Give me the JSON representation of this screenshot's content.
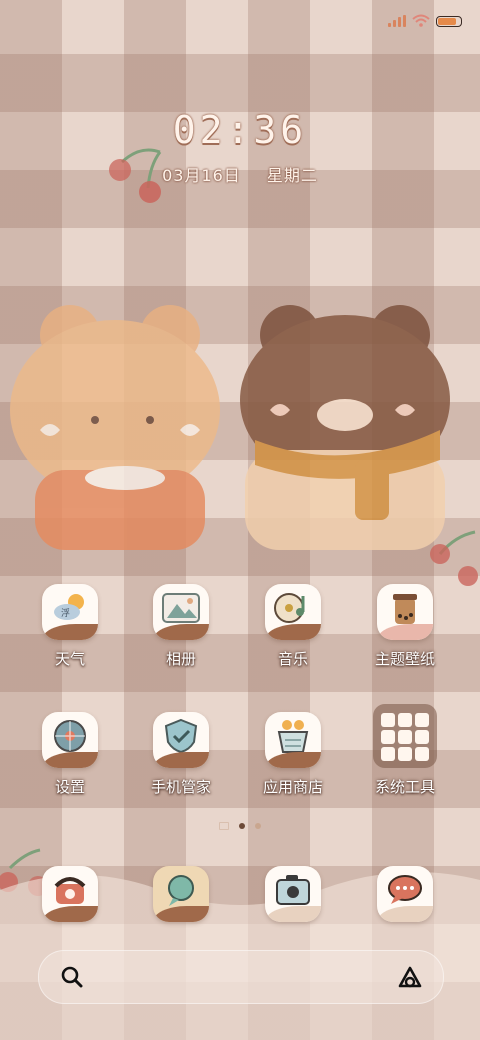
{
  "status": {
    "signal_icon": "signal-icon",
    "wifi_icon": "wifi-icon",
    "battery_icon": "battery-icon",
    "battery_level": 0.8
  },
  "clock": {
    "time": "02:36",
    "month_day": "03月16日",
    "weekday": "星期二"
  },
  "colors": {
    "label_shadow": "#3c1e14",
    "icon_bg": "#fffaf5",
    "icon_base": "#a0694a",
    "accent": "#e58a4a"
  },
  "apps_row1": [
    {
      "label": "天气",
      "icon": "weather-icon"
    },
    {
      "label": "相册",
      "icon": "gallery-icon"
    },
    {
      "label": "音乐",
      "icon": "music-icon"
    },
    {
      "label": "主题壁纸",
      "icon": "theme-icon"
    }
  ],
  "apps_row2": [
    {
      "label": "设置",
      "icon": "settings-icon"
    },
    {
      "label": "手机管家",
      "icon": "security-icon"
    },
    {
      "label": "应用商店",
      "icon": "store-icon"
    },
    {
      "label": "系统工具",
      "icon": "folder-icon"
    }
  ],
  "dock": [
    {
      "icon": "phone-icon"
    },
    {
      "icon": "contacts-icon"
    },
    {
      "icon": "camera-icon"
    },
    {
      "icon": "messages-icon"
    }
  ],
  "search": {
    "search_icon": "search-icon",
    "assistant_icon": "assistant-icon"
  }
}
